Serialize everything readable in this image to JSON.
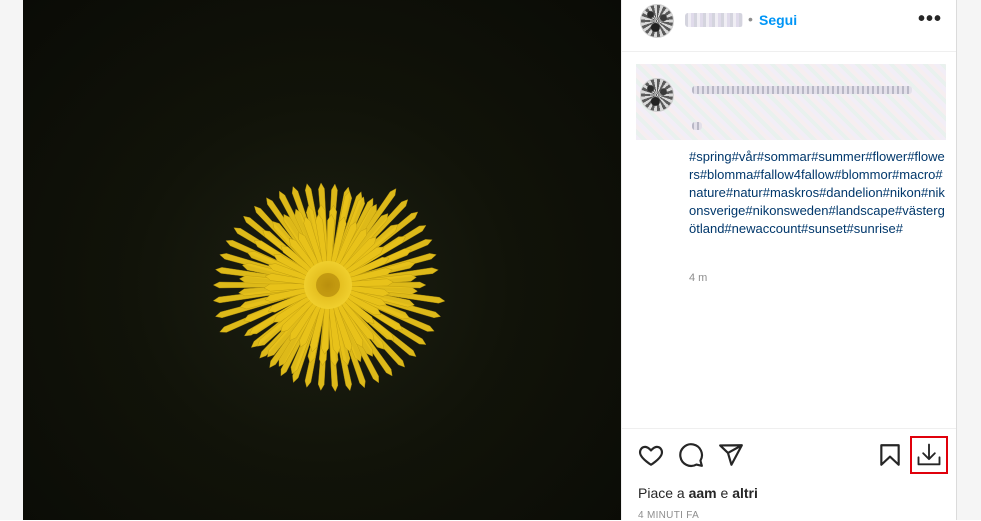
{
  "post": {
    "follow_label": "Segui",
    "separator": "•",
    "more_label": "•••",
    "hashtags": "#spring#vår#sommar#summer#flower#flowers#blomma#fallow4fallow#blommor#macro#nature#natur#maskros#dandelion#nikon#nikonsverige#nikonsweden#landscape#västergötland#newaccount#sunset#sunrise#",
    "caption_time": "4 m",
    "likes_prefix": "Piace a ",
    "likes_user": "aam",
    "likes_middle": " e ",
    "likes_others": "altri",
    "posted_when": "4 MINUTI FA"
  },
  "icons": {
    "like": "heart-icon",
    "comment": "comment-icon",
    "share": "paper-plane-icon",
    "save": "bookmark-icon",
    "download": "download-icon"
  },
  "colors": {
    "link_blue": "#0095f6",
    "hashtag": "#00376b",
    "highlight": "#e0000b",
    "flower": "#e8c21a"
  }
}
